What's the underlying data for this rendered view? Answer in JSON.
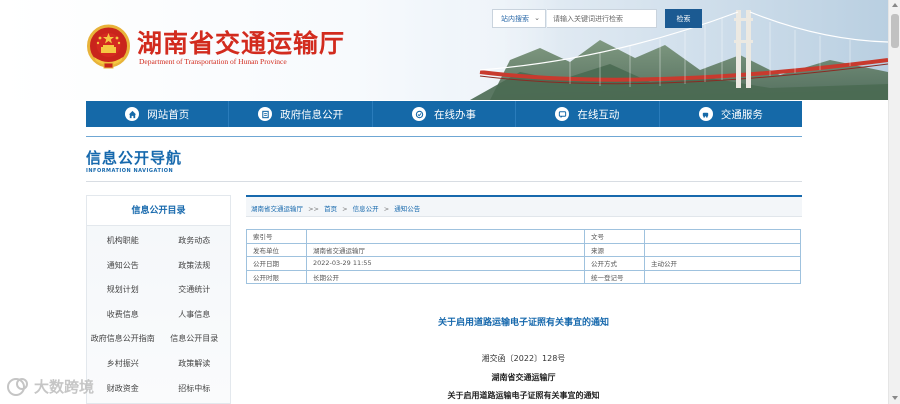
{
  "header": {
    "title": "湖南省交通运输厅",
    "subtitle": "Department of Transportation of Hunan Province",
    "search": {
      "scope": "站内搜索",
      "placeholder": "请输入关键词进行检索",
      "button": "检索"
    }
  },
  "nav": {
    "items": [
      {
        "label": "网站首页",
        "icon": "home-icon"
      },
      {
        "label": "政府信息公开",
        "icon": "document-icon"
      },
      {
        "label": "在线办事",
        "icon": "online-service-icon"
      },
      {
        "label": "在线互动",
        "icon": "chat-icon"
      },
      {
        "label": "交通服务",
        "icon": "traffic-service-icon"
      }
    ]
  },
  "section": {
    "title": "信息公开导航",
    "subtitle": "INFORMATION NAVIGATION"
  },
  "sidebar": {
    "heading": "信息公开目录",
    "items": [
      "机构职能",
      "政务动态",
      "通知公告",
      "政策法规",
      "规划计划",
      "交通统计",
      "收费信息",
      "人事信息",
      "政府信息公开指南",
      "信息公开目录",
      "乡村振兴",
      "政策解读",
      "财政资金",
      "招标中标"
    ]
  },
  "breadcrumb": {
    "root": "湖南省交通运输厅",
    "home": "首页",
    "sep_main": ">>",
    "sep": ">",
    "section": "信息公开",
    "current": "通知公告"
  },
  "info": {
    "rows": [
      {
        "k1": "索引号",
        "v1": "",
        "k2": "文号",
        "v2": ""
      },
      {
        "k1": "发布单位",
        "v1": "湖南省交通运输厅",
        "k2": "来源",
        "v2": ""
      },
      {
        "k1": "公开日期",
        "v1": "2022-03-29 11:55",
        "k2": "公开方式",
        "v2": "主动公开"
      },
      {
        "k1": "公开时限",
        "v1": "长期公开",
        "k2": "统一登记号",
        "v2": ""
      }
    ]
  },
  "document": {
    "title": "关于启用道路运输电子证照有关事宜的通知",
    "number": "湘交函〔2022〕128号",
    "issuer": "湖南省交通运输厅",
    "subject": "关于启用道路运输电子证照有关事宜的通知"
  },
  "watermark": {
    "text": "大数跨境"
  },
  "colors": {
    "brand_red": "#d22b1e",
    "nav_blue": "#1569a8",
    "accent_blue": "#1769ad"
  }
}
